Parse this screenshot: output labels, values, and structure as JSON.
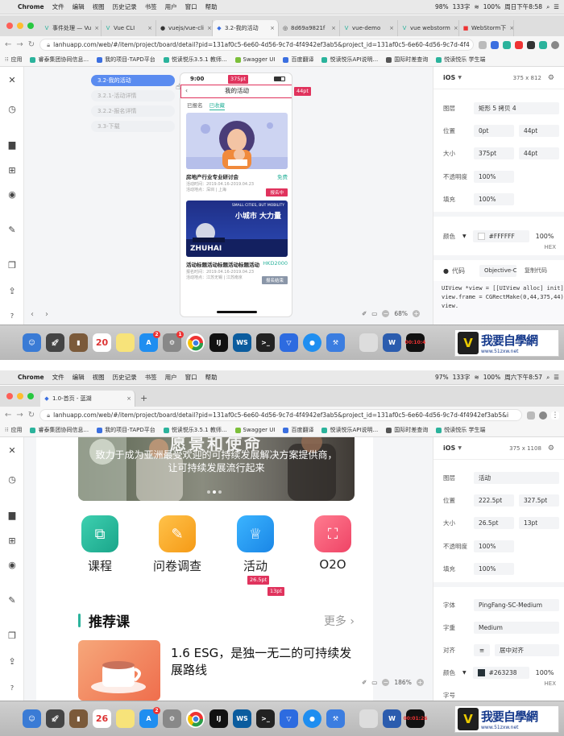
{
  "menubar": {
    "app": "Chrome",
    "items": [
      "文件",
      "编辑",
      "视图",
      "历史记录",
      "书签",
      "用户",
      "窗口",
      "帮助"
    ],
    "battery": "98%",
    "network": "133字",
    "wifi_battery": "100%",
    "datetime_1": "周日下午8:58",
    "datetime_2": "周六下午8:57",
    "battery_2": "97%",
    "network_2": "133字"
  },
  "s1": {
    "tabs": [
      "事件处理 — Vu",
      "Vue CLI",
      "vuejs/vue-cli",
      "3.2-我的活动",
      "8d69a9821f",
      "vue-demo",
      "vue webstorm",
      "WebStorm下"
    ],
    "url": "lanhuapp.com/web/#/item/project/board/detail?pid=131af0c5-6e60-4d56-9c7d-4f4942ef3ab5&project_id=131af0c5-6e60-4d56-9c7d-4f4",
    "bookmarks": [
      "应用",
      "睿泰集团协同信息...",
      "我的项目-TAPD平台",
      "悦读悦乐3.5.1 教师...",
      "Swagger UI",
      "百度翻译",
      "悦读悦乐API说明...",
      "国际时差查询",
      "悦读悦乐 学生端"
    ],
    "nodes": [
      "3.2-我的活动",
      "3.2.1-活动详情",
      "3.2.2-报名详情",
      "3.3-下载"
    ],
    "phone": {
      "time": "9:00",
      "title": "我的活动",
      "tabs": [
        "已报名",
        "已收藏"
      ],
      "card1": {
        "title": "房地产行业专业研讨会",
        "price": "免费",
        "line1": "活动时间：2019.04.16-2019.04.23",
        "line2": "活动地点：深圳 | 上海",
        "btn": "报名中"
      },
      "card2": {
        "banner1": "SMALL CITIES, BUT MOBILITY",
        "banner2": "小城市 大力量",
        "banner3": "ZHUHAI",
        "title": "活动标题活动标题活动标题活动",
        "price": "HKD2000",
        "line1": "报名时间：2019.04.16-2019.04.23",
        "line2": "活动地点：江苏无锡 | 江苏南京",
        "btn": "报名结束"
      }
    },
    "tag_w": "375pt",
    "tag_h": "44pt",
    "zoom": "68%",
    "panel": {
      "os": "iOS",
      "dims": "375 x 812",
      "layer_label": "图层",
      "layer": "矩形 5 拷贝 4",
      "pos_label": "位置",
      "x": "0pt",
      "y": "44pt",
      "size_label": "大小",
      "w": "375pt",
      "h": "44pt",
      "op_label": "不透明度",
      "opacity": "100%",
      "fill_label": "填充",
      "fill": "100%",
      "color_label": "颜色",
      "color": "#FFFFFF",
      "color_op": "100%",
      "hex": "HEX",
      "code_label": "代码",
      "lang": "Objective-C",
      "copy": "复制代码",
      "code1": "UIView *view = [[UIView alloc] init];",
      "code2": "view.frame = CGRectMake(0,44,375,44);",
      "code3": "view."
    },
    "brand_color": "#2bb39c",
    "accent_color": "#e0335d"
  },
  "s2": {
    "tab": "1.0-首页 - 蓝湖",
    "url": "lanhuapp.com/web/#/item/project/board/detail?pid=131af0c5-6e60-4d56-9c7d-4f4942ef3ab5&project_id=131af0c5-6e60-4d56-9c7d-4f4942ef3ab5&i",
    "hero_title": "愿景和使命",
    "hero_sub1": "致力于成为亚洲最受欢迎的可持续发展解决方案提供商，",
    "hero_sub2": "让可持续发展流行起来",
    "categories": [
      "课程",
      "问卷调查",
      "活动",
      "O2O"
    ],
    "tag_w": "26.5pt",
    "tag_h": "13pt",
    "section_title": "推荐课",
    "more": "更多",
    "course_title": "1.6 ESG，是独一无二的可持续发展路线",
    "zoom": "186%",
    "panel": {
      "os": "iOS",
      "dims": "375 x 1108",
      "layer_label": "图层",
      "layer": "活动",
      "pos_label": "位置",
      "x": "222.5pt",
      "y": "327.5pt",
      "size_label": "大小",
      "w": "26.5pt",
      "h": "13pt",
      "op_label": "不透明度",
      "opacity": "100%",
      "fill_label": "填充",
      "fill": "100%",
      "font_label": "字体",
      "font": "PingFang-SC-Medium",
      "weight_label": "字重",
      "weight": "Medium",
      "align_label": "对齐",
      "align": "居中对齐",
      "color_label": "颜色",
      "color": "#263238",
      "color_op": "100%",
      "hex": "HEX",
      "size_label2": "字号"
    }
  },
  "dock": {
    "calendar_1": "20",
    "calendar_2": "26",
    "timer_1": "00:10:4",
    "timer_2": "00:01:26",
    "watermark_1": "我要自學網",
    "watermark_2": "www.51zxw.net"
  }
}
